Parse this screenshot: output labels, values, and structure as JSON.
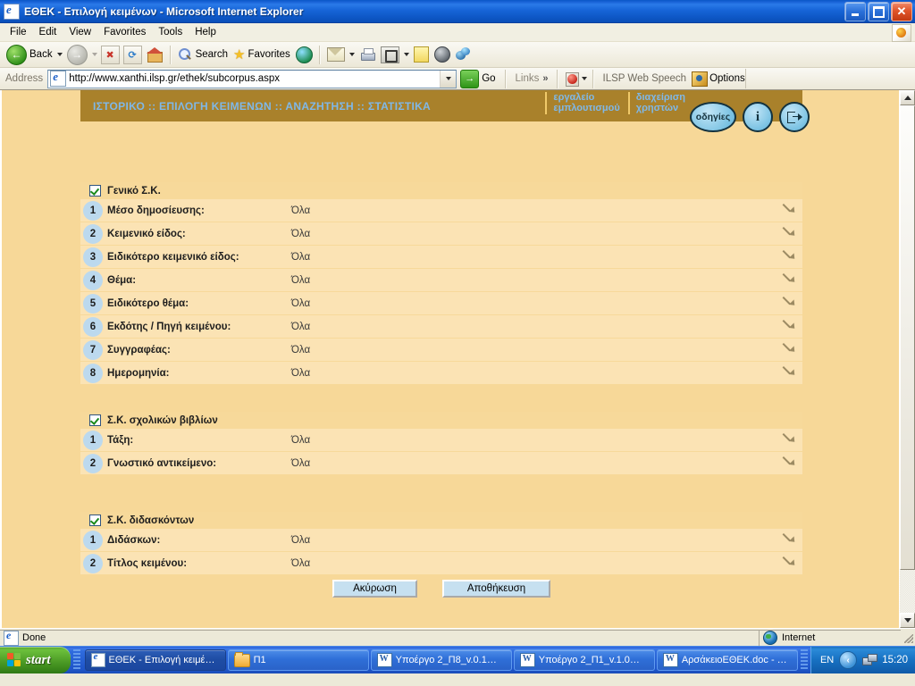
{
  "window": {
    "title": "ΕΘΕΚ - Επιλογή κειμένων - Microsoft Internet Explorer",
    "icon": "ie-document-icon",
    "controls": {
      "minimize": "minimize",
      "restore": "restore",
      "close": "close"
    }
  },
  "menubar": {
    "items": [
      "File",
      "Edit",
      "View",
      "Favorites",
      "Tools",
      "Help"
    ]
  },
  "toolbar": {
    "back_label": "Back",
    "forward_label": "",
    "stop_label": "",
    "refresh_label": "",
    "home_label": "",
    "search_label": "Search",
    "favorites_label": "Favorites",
    "media_label": ""
  },
  "addressbar": {
    "label": "Address",
    "url": "http://www.xanthi.ilsp.gr/ethek/subcorpus.aspx",
    "go_label": "Go",
    "links_label": "Links",
    "chevron": "»",
    "speech_label": "ILSP Web Speech",
    "options_label": "Options"
  },
  "page": {
    "nav": {
      "main": "ΙΣΤΟΡΙΚΟ :: ΕΠΙΛΟΓΗ ΚΕΙΜΕΝΩΝ :: ΑΝΑΖΗΤΗΣΗ :: ΣΤΑΤΙΣΤΙΚΑ",
      "col1_line1": "εργαλείο",
      "col1_line2": "εμπλουτισμού",
      "col2_line1": "διαχείριση",
      "col2_line2": "χρηστών",
      "help_button": "οδηγίες",
      "info_button": "i",
      "exit_button": ""
    },
    "colors": {
      "page_background": "#f7d898",
      "navbar": "#a9812b",
      "nav_text": "#7fb8e8",
      "group_background": "#fbe3b4",
      "group_header": "#f7d99a",
      "badge": "#bcd9ee",
      "button": "#c6e0f0"
    },
    "groups": [
      {
        "checked": true,
        "title": "Γενικό Σ.Κ.",
        "rows": [
          {
            "num": "1",
            "label": "Μέσο δημοσίευσης:",
            "value": "Όλα"
          },
          {
            "num": "2",
            "label": "Κειμενικό είδος:",
            "value": "Όλα"
          },
          {
            "num": "3",
            "label": "Ειδικότερο κειμενικό είδος:",
            "value": "Όλα"
          },
          {
            "num": "4",
            "label": "Θέμα:",
            "value": "Όλα"
          },
          {
            "num": "5",
            "label": "Ειδικότερο θέμα:",
            "value": "Όλα"
          },
          {
            "num": "6",
            "label": "Εκδότης / Πηγή κειμένου:",
            "value": "Όλα"
          },
          {
            "num": "7",
            "label": "Συγγραφέας:",
            "value": "Όλα"
          },
          {
            "num": "8",
            "label": "Ημερομηνία:",
            "value": "Όλα"
          }
        ]
      },
      {
        "checked": true,
        "title": "Σ.Κ. σχολικών βιβλίων",
        "rows": [
          {
            "num": "1",
            "label": "Τάξη:",
            "value": "Όλα"
          },
          {
            "num": "2",
            "label": "Γνωστικό αντικείμενο:",
            "value": "Όλα"
          }
        ]
      },
      {
        "checked": true,
        "title": "Σ.Κ. διδασκόντων",
        "rows": [
          {
            "num": "1",
            "label": "Διδάσκων:",
            "value": "Όλα"
          },
          {
            "num": "2",
            "label": "Τίτλος κειμένου:",
            "value": "Όλα"
          }
        ]
      }
    ],
    "buttons": {
      "cancel": "Ακύρωση",
      "save": "Αποθήκευση"
    }
  },
  "statusbar": {
    "status": "Done",
    "zone": "Internet"
  },
  "taskbar": {
    "start": "start",
    "tasks": [
      {
        "label": "ΕΘΕΚ - Επιλογή κειμέ…",
        "icon": "ie-icon",
        "active": true
      },
      {
        "label": "Π1",
        "icon": "folder-icon",
        "active": false
      },
      {
        "label": "Υποέργο 2_Π8_v.0.1…",
        "icon": "word-icon",
        "active": false
      },
      {
        "label": "Υποέργο 2_Π1_v.1.0…",
        "icon": "word-icon",
        "active": false
      },
      {
        "label": "ΑρσάκειοΕΘΕΚ.doc - …",
        "icon": "word-icon",
        "active": false
      }
    ],
    "tray": {
      "language": "EN",
      "chevron": "‹",
      "time": "15:20"
    }
  }
}
